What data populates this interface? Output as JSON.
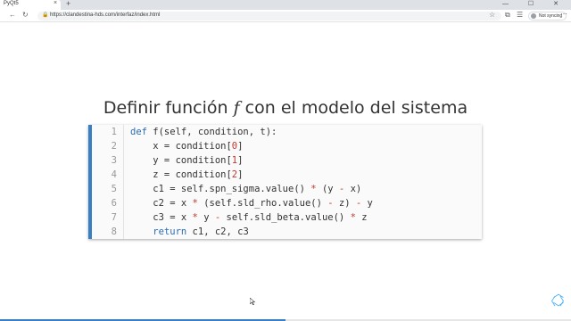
{
  "browser": {
    "tab_title": "PyQt5",
    "tab_close": "×",
    "new_tab": "+",
    "window_controls": "— ☐ ✕",
    "url": "https://clandestina-hds.com/interfaz/index.html",
    "sync_label": "Not syncing",
    "icons": [
      "back-arrow-icon",
      "reload-icon",
      "lock-icon",
      "star-icon",
      "extensions-icon",
      "collections-icon",
      "menu-icon"
    ]
  },
  "slide": {
    "title_prefix": "Definir función",
    "title_fn": "f",
    "title_suffix": "con el modelo del sistema",
    "code": {
      "language": "python",
      "line_numbers": [
        "1",
        "2",
        "3",
        "4",
        "5",
        "6",
        "7",
        "8"
      ],
      "lines": [
        "def f(self, condition, t):",
        "    x = condition[0]",
        "    y = condition[1]",
        "    z = condition[2]",
        "    c1 = self.spn_sigma.value() * (y - x)",
        "    c2 = x * (self.sld_rho.value() - z) - y",
        "    c3 = x * y - self.sld_beta.value() * z",
        "    return c1, c2, c3"
      ]
    },
    "progress_fraction": 0.5
  },
  "colors": {
    "accent": "#3a7fc1",
    "keyword": "#2a6bb3",
    "number": "#c0392b",
    "nav_arrow": "#42affa"
  }
}
